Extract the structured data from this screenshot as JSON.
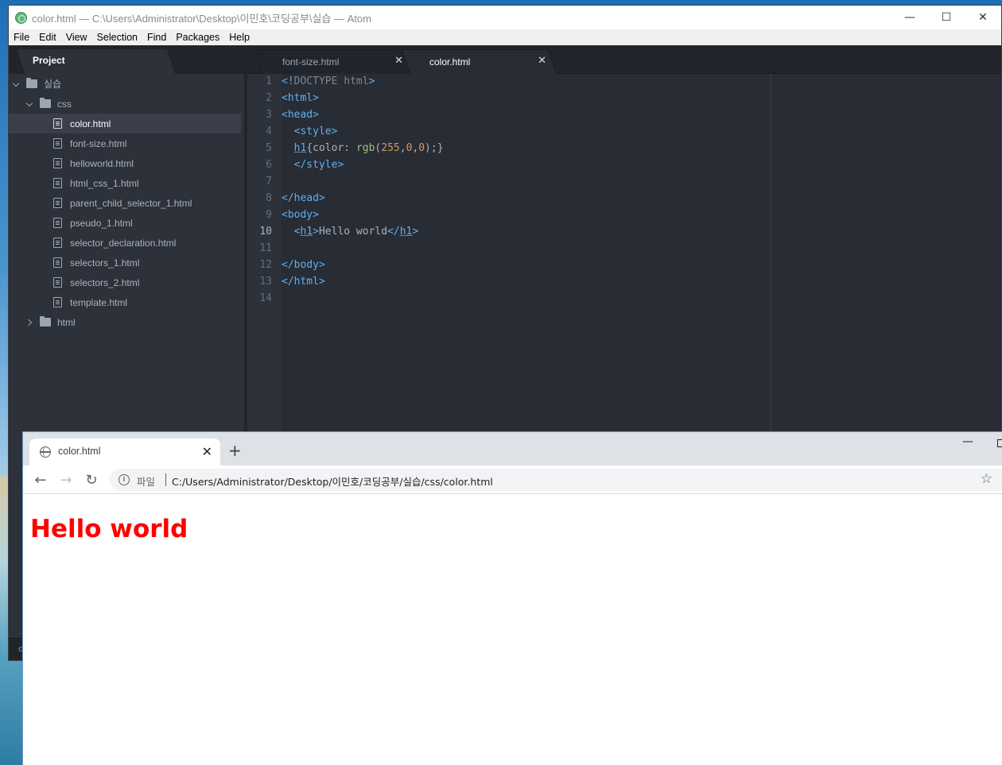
{
  "atom": {
    "title": "color.html — C:\\Users\\Administrator\\Desktop\\이민호\\코딩공부\\실습 — Atom",
    "window_controls": [
      "—",
      "☐",
      "✕"
    ],
    "menu": [
      "File",
      "Edit",
      "View",
      "Selection",
      "Find",
      "Packages",
      "Help"
    ],
    "tree_tab": "Project",
    "tree": {
      "root": "실습",
      "css_folder": "css",
      "files": [
        "color.html",
        "font-size.html",
        "helloworld.html",
        "html_css_1.html",
        "parent_child_selector_1.html",
        "pseudo_1.html",
        "selector_declaration.html",
        "selectors_1.html",
        "selectors_2.html",
        "template.html"
      ],
      "html_folder": "html",
      "selected": "color.html"
    },
    "tabs": [
      {
        "label": "font-size.html",
        "close": "✕"
      },
      {
        "label": "color.html",
        "close": "✕"
      }
    ],
    "line_numbers": [
      "1",
      "2",
      "3",
      "4",
      "5",
      "6",
      "7",
      "8",
      "9",
      "10",
      "11",
      "12",
      "13",
      "14"
    ],
    "current_line": 10,
    "status_peek": "c"
  },
  "chrome": {
    "tab_label": "color.html",
    "tab_close": "✕",
    "new_tab": "+",
    "nav": {
      "back": "←",
      "forward": "→",
      "reload": "↻"
    },
    "site_info": "i",
    "chip": "파일",
    "url": "C:/Users/Administrator/Desktop/이민호/코딩공부/실습/css/color.html",
    "star": "☆",
    "page_heading": "Hello world",
    "heading_color": "#ff0000"
  }
}
